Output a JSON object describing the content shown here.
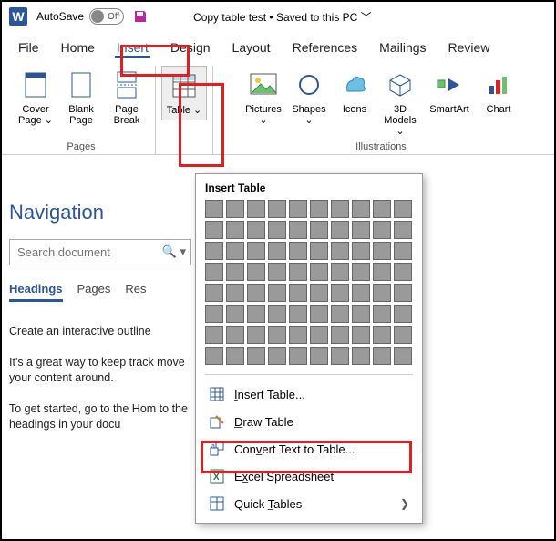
{
  "titlebar": {
    "autosave_label": "AutoSave",
    "autosave_state": "Off",
    "doc_title": "Copy table test • Saved to this PC ﹀"
  },
  "tabs": {
    "file": "File",
    "home": "Home",
    "insert": "Insert",
    "design": "Design",
    "layout": "Layout",
    "references": "References",
    "mailings": "Mailings",
    "review": "Review"
  },
  "ribbon": {
    "pages": {
      "group_label": "Pages",
      "cover_page": "Cover Page ⌄",
      "blank_page": "Blank Page",
      "page_break": "Page Break"
    },
    "tables": {
      "table": "Table ⌄"
    },
    "illustrations": {
      "group_label": "Illustrations",
      "pictures": "Pictures ⌄",
      "shapes": "Shapes ⌄",
      "icons": "Icons",
      "models3d": "3D Models ⌄",
      "smartart": "SmartArt",
      "chart": "Chart"
    }
  },
  "nav": {
    "title": "Navigation",
    "search_placeholder": "Search document",
    "tab_headings": "Headings",
    "tab_pages": "Pages",
    "tab_results": "Res",
    "body1": "Create an interactive outline",
    "body2": "It's a great way to keep track move your content around.",
    "body3": "To get started, go to the Hom to the headings in your docu"
  },
  "panel": {
    "title": "Insert Table",
    "insert_table": "Insert Table...",
    "draw_table": "Draw Table",
    "convert": "Convert Text to Table...",
    "excel": "Excel Spreadsheet",
    "quick": "Quick Tables"
  }
}
